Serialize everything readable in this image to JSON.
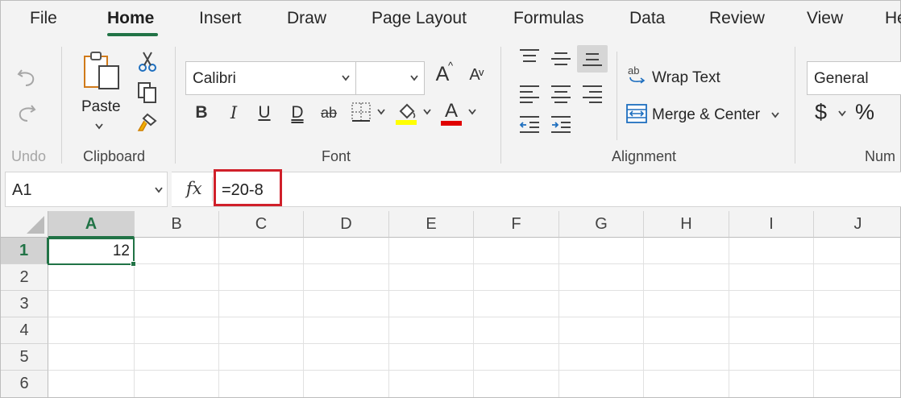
{
  "menu": {
    "tabs": [
      {
        "label": "File"
      },
      {
        "label": "Home"
      },
      {
        "label": "Insert"
      },
      {
        "label": "Draw"
      },
      {
        "label": "Page Layout"
      },
      {
        "label": "Formulas"
      },
      {
        "label": "Data"
      },
      {
        "label": "Review"
      },
      {
        "label": "View"
      },
      {
        "label": "He"
      }
    ],
    "active_tab": "Home"
  },
  "ribbon": {
    "undo": {
      "group_label": "Undo"
    },
    "clipboard": {
      "paste_label": "Paste",
      "group_label": "Clipboard"
    },
    "font": {
      "font_name": "Calibri",
      "font_size": "",
      "grow_label": "A",
      "shrink_label": "A",
      "bold_label": "B",
      "italic_label": "I",
      "underline_label": "U",
      "double_underline_label": "D",
      "strike_label": "ab",
      "font_color_label": "A",
      "fill_color": "#ffff00",
      "font_color": "#e00000",
      "group_label": "Font"
    },
    "alignment": {
      "wrap_text_label": "Wrap Text",
      "wrap_icon_label": "ab",
      "merge_center_label": "Merge & Center",
      "group_label": "Alignment"
    },
    "number": {
      "format": "General",
      "currency_label": "$",
      "percent_label": "%",
      "group_label": "Num"
    }
  },
  "formula_bar": {
    "name_box": "A1",
    "fx_label": "fx",
    "formula": "=20-8",
    "highlight_color": "#d0202a"
  },
  "grid": {
    "columns": [
      "A",
      "B",
      "C",
      "D",
      "E",
      "F",
      "G",
      "H",
      "I",
      "J"
    ],
    "rows": [
      "1",
      "2",
      "3",
      "4",
      "5",
      "6"
    ],
    "selected_column": "A",
    "selected_row": "1",
    "cells": {
      "A1": "12"
    },
    "accent": "#217346"
  }
}
